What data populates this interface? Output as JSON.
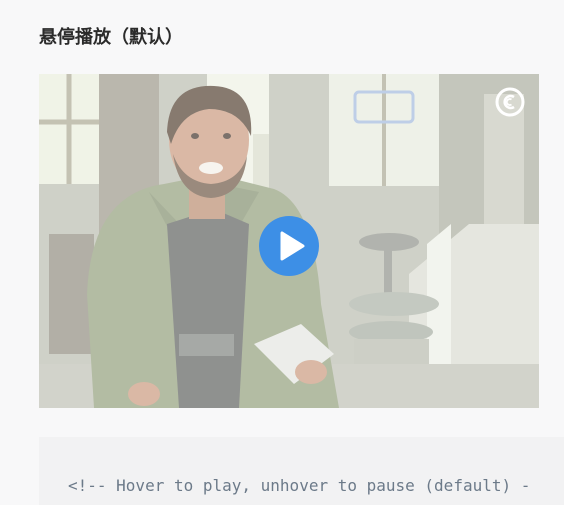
{
  "section": {
    "title": "悬停播放（默认）"
  },
  "video": {
    "state": "paused",
    "overlay_icon": "play-icon",
    "watermark_icon": "comedy-central-logo-icon",
    "play_button_color": "#3d8fe6"
  },
  "code": {
    "line": "<!-- Hover to play, unhover to pause (default) -"
  }
}
